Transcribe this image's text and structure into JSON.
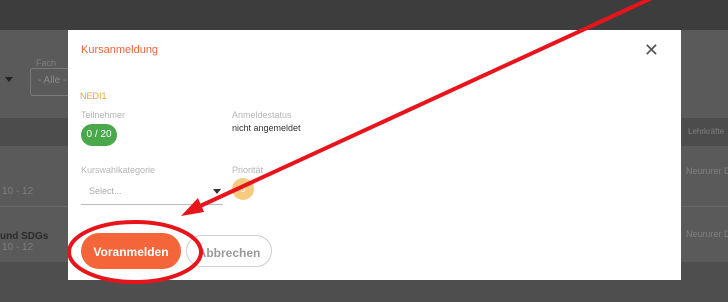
{
  "background": {
    "filter_label": "Fach",
    "filter_value": "- Alle -",
    "column_header": "Lehrkräfte",
    "rows": [
      {
        "grade": "10 - 12",
        "teacher": "Neururer Die"
      },
      {
        "course": "und SDGs",
        "grade": "10 - 12",
        "teacher": "Neururer Die"
      }
    ]
  },
  "modal": {
    "title": "Kursanmeldung",
    "close_glyph": "✕",
    "course_code": "NEDI1",
    "participants_label": "Teilnehmer",
    "participants_count": "0 / 20",
    "status_label": "Anmeldestatus",
    "status_value": "nicht angemeldet",
    "category_label": "Kurswahlkategorie",
    "category_placeholder": "Select...",
    "priority_label": "Priorität",
    "priority_value": "0",
    "primary_button": "Voranmelden",
    "secondary_button": "Abbrechen"
  },
  "colors": {
    "accent": "#f4663a",
    "title": "#e8643c",
    "course_code": "#f0a030",
    "participants_badge": "#49a84a",
    "priority_badge": "#f8cc80",
    "annotation": "#e8141c"
  }
}
